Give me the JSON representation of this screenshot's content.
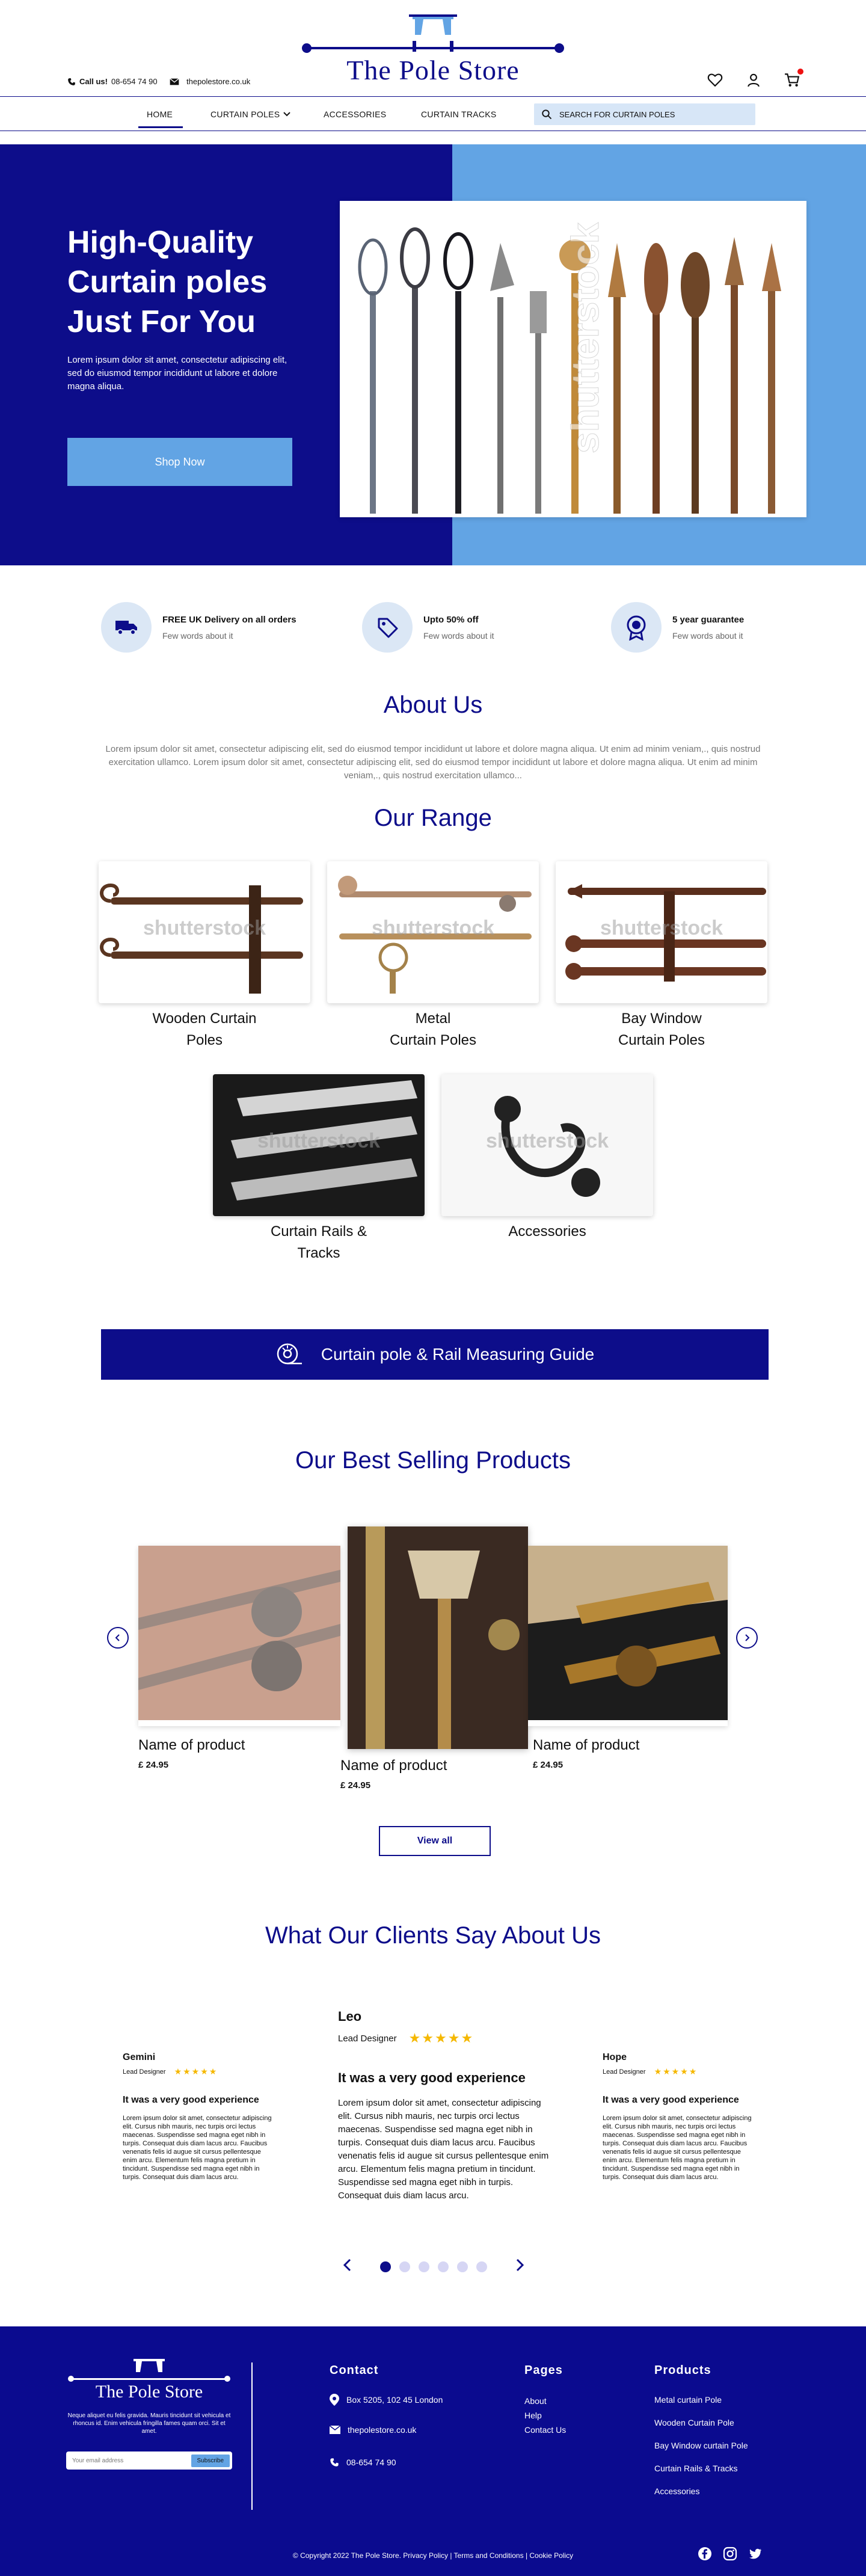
{
  "header": {
    "brand": "The Pole Store",
    "call_label": "Call us!",
    "phone": "08-654 74 90",
    "email": "thepolestore.co.uk"
  },
  "nav": {
    "items": [
      "HOME",
      "CURTAIN POLES",
      "ACCESSORIES",
      "CURTAIN TRACKS"
    ],
    "search_placeholder": "SEARCH FOR CURTAIN POLES"
  },
  "hero": {
    "title_line1": "High-Quality",
    "title_line2": "Curtain poles",
    "title_line3": "Just For You",
    "subtitle": "Lorem ipsum dolor sit amet, consectetur adipiscing elit, sed do eiusmod tempor incididunt ut labore et dolore magna aliqua.",
    "button": "Shop Now",
    "watermark": "shutterstock"
  },
  "features": [
    {
      "title": "FREE UK Delivery on all orders",
      "sub": "Few words about it",
      "icon": "truck-icon"
    },
    {
      "title": "Upto 50% off",
      "sub": "Few words about it",
      "icon": "tag-icon"
    },
    {
      "title": "5 year guarantee",
      "sub": "Few words about it",
      "icon": "badge-icon"
    }
  ],
  "about": {
    "title": "About Us",
    "text": "Lorem ipsum dolor sit amet, consectetur adipiscing elit, sed do eiusmod tempor incididunt ut labore et dolore magna aliqua. Ut enim ad minim veniam,., quis nostrud exercitation ullamco. Lorem ipsum dolor sit amet, consectetur adipiscing elit, sed do eiusmod tempor incididunt ut labore et dolore magna aliqua. Ut enim ad minim veniam,., quis nostrud exercitation ullamco..."
  },
  "range": {
    "title": "Our Range",
    "items": [
      {
        "label_l1": "Wooden Curtain",
        "label_l2": "Poles"
      },
      {
        "label_l1": "Metal",
        "label_l2": "Curtain Poles"
      },
      {
        "label_l1": "Bay Window",
        "label_l2": "Curtain Poles"
      },
      {
        "label_l1": "Curtain Rails &",
        "label_l2": "Tracks"
      },
      {
        "label_l1": "Accessories",
        "label_l2": ""
      }
    ],
    "watermark": "shutterstock"
  },
  "guide": {
    "label": "Curtain pole & Rail Measuring Guide"
  },
  "products": {
    "title": "Our Best Selling Products",
    "items": [
      {
        "name": "Name of product",
        "price": "£ 24.95"
      },
      {
        "name": "Name of product",
        "price": "£ 24.95"
      },
      {
        "name": "Name of product",
        "price": "£ 24.95"
      }
    ],
    "view_all": "View all"
  },
  "testimonials": {
    "title": "What Our Clients Say About Us",
    "items": [
      {
        "name": "Gemini",
        "role": "Lead Designer",
        "heading": "It was a very good experience",
        "body": "Lorem ipsum dolor sit amet, consectetur adipiscing elit. Cursus nibh mauris, nec turpis orci lectus maecenas. Suspendisse sed magna eget nibh in turpis. Consequat duis diam lacus arcu. Faucibus venenatis felis id augue sit cursus pellentesque enim arcu. Elementum felis magna pretium in tincidunt. Suspendisse sed magna eget nibh in turpis. Consequat duis diam lacus arcu."
      },
      {
        "name": "Leo",
        "role": "Lead Designer",
        "heading": "It was a very good experience",
        "body": "Lorem ipsum dolor sit amet, consectetur adipiscing elit. Cursus nibh mauris, nec turpis orci lectus maecenas. Suspendisse sed magna eget nibh in turpis. Consequat duis diam lacus arcu. Faucibus venenatis felis id augue sit cursus pellentesque enim arcu. Elementum felis magna pretium in tincidunt. Suspendisse sed magna eget nibh in turpis. Consequat duis diam lacus arcu."
      },
      {
        "name": "Hope",
        "role": "Lead Designer",
        "heading": "It was a very good experience",
        "body": "Lorem ipsum dolor sit amet, consectetur adipiscing elit. Cursus nibh mauris, nec turpis orci lectus maecenas. Suspendisse sed magna eget nibh in turpis. Consequat duis diam lacus arcu. Faucibus venenatis felis id augue sit cursus pellentesque enim arcu. Elementum felis magna pretium in tincidunt. Suspendisse sed magna eget nibh in turpis. Consequat duis diam lacus arcu."
      }
    ],
    "stars": "★★★★★",
    "active_slide": 1,
    "slide_count": 6
  },
  "footer": {
    "brand": "The Pole Store",
    "tagline": "Neque aliquet eu felis gravida. Mauris tincidunt sit vehicula et rhoncus id. Enim vehicula fringilla fames quam orci. Sit et amet.",
    "email_placeholder": "Your email address",
    "subscribe": "Subscribe",
    "contact_head": "Contact",
    "address": "Box 5205, 102 45 London",
    "email": "thepolestore.co.uk",
    "phone": "08-654 74 90",
    "pages_head": "Pages",
    "pages": [
      "About",
      "Help",
      "Contact Us"
    ],
    "products_head": "Products",
    "products": [
      "Metal curtain Pole",
      "Wooden Curtain Pole",
      "Bay Window curtain Pole",
      "Curtain Rails & Tracks",
      "Accessories"
    ],
    "copyright": "© Copyright 2022 The Pole Store. Privacy Policy | Terms and Conditions | Cookie Policy"
  },
  "colors": {
    "navy": "#0d0d8a",
    "light_blue": "#62a4e4",
    "star": "#f5b800"
  }
}
